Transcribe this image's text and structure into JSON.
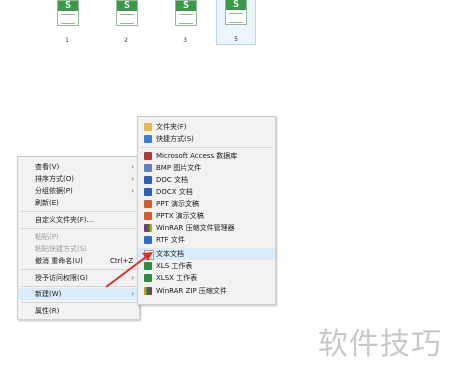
{
  "files": [
    {
      "label": "1",
      "badge": "S",
      "selected": false
    },
    {
      "label": "2",
      "badge": "S",
      "selected": false
    },
    {
      "label": "3",
      "badge": "S",
      "selected": false
    },
    {
      "label": "4",
      "badge": "S",
      "selected": false
    },
    {
      "label": "5",
      "badge": "S",
      "selected": true
    }
  ],
  "context_menu": {
    "items": [
      {
        "label": "查看(V)",
        "submenu": true
      },
      {
        "label": "排序方式(O)",
        "submenu": true
      },
      {
        "label": "分组依据(P)",
        "submenu": true
      },
      {
        "label": "刷新(E)"
      },
      {
        "label": "自定义文件夹(F)..."
      },
      {
        "label": "粘贴(P)",
        "disabled": true
      },
      {
        "label": "粘贴快捷方式(S)",
        "disabled": true
      },
      {
        "label": "撤消 重命名(U)",
        "shortcut": "Ctrl+Z"
      },
      {
        "label": "授予访问权限(G)",
        "submenu": true
      },
      {
        "label": "新建(W)",
        "submenu": true,
        "highlighted": true
      },
      {
        "label": "属性(R)"
      }
    ]
  },
  "new_submenu": {
    "items": [
      {
        "label": "文件夹(F)",
        "icon": "folder-icon"
      },
      {
        "label": "快捷方式(S)",
        "icon": "shortcut-icon"
      },
      {
        "label": "Microsoft Access 数据库",
        "icon": "access-icon"
      },
      {
        "label": "BMP 图片文件",
        "icon": "bmp-icon"
      },
      {
        "label": "DOC 文档",
        "icon": "doc-icon"
      },
      {
        "label": "DOCX 文档",
        "icon": "docx-icon"
      },
      {
        "label": "PPT 演示文稿",
        "icon": "ppt-icon"
      },
      {
        "label": "PPTX 演示文稿",
        "icon": "pptx-icon"
      },
      {
        "label": "WinRAR 压缩文件管理器",
        "icon": "winrar-icon"
      },
      {
        "label": "RTF 文件",
        "icon": "rtf-icon"
      },
      {
        "label": "文本文档",
        "icon": "text-document-icon",
        "highlighted": true
      },
      {
        "label": "XLS 工作表",
        "icon": "xls-icon"
      },
      {
        "label": "XLSX 工作表",
        "icon": "xlsx-icon"
      },
      {
        "label": "WinRAR ZIP 压缩文件",
        "icon": "winrar-zip-icon"
      }
    ]
  },
  "watermark": "软件技巧",
  "colors": {
    "highlight": "#d9ecfb",
    "annotation_arrow": "#e0322a",
    "spreadsheet_green": "#3a9a4a"
  }
}
